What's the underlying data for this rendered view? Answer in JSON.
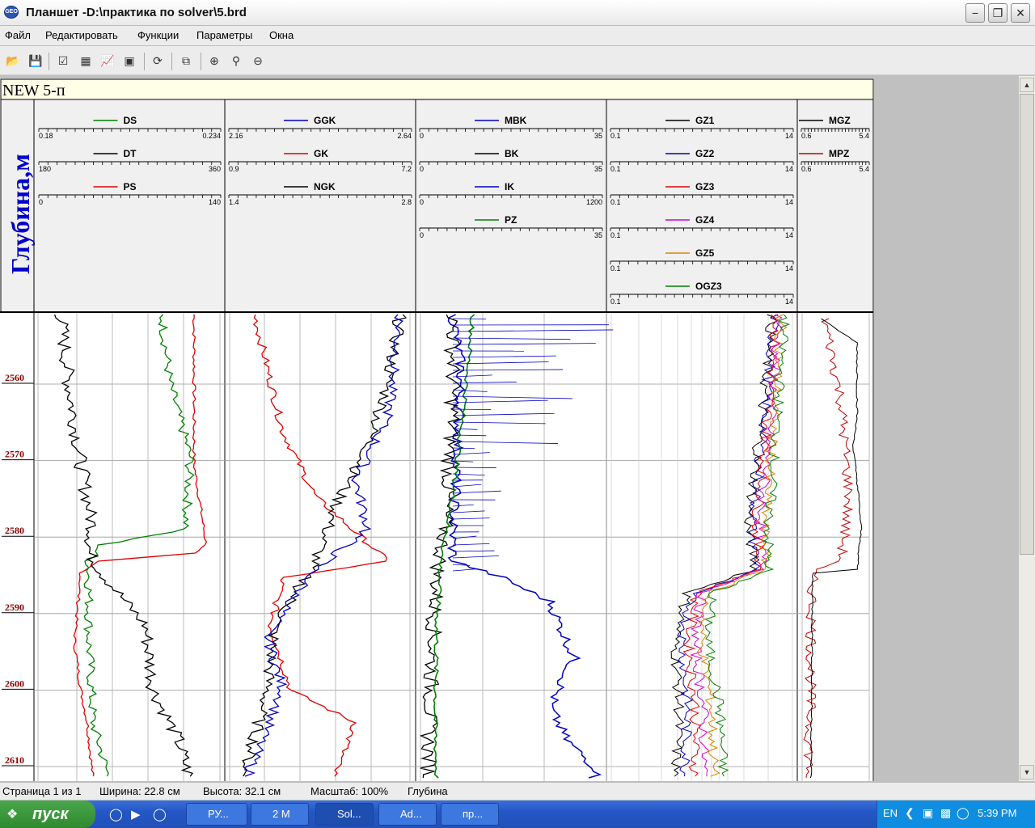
{
  "window": {
    "title": "Планшет -D:\\практика по solver\\5.brd",
    "app_icon": "GEO"
  },
  "menu": [
    "Файл",
    "Редактировать",
    "Функции",
    "Параметры",
    "Окна"
  ],
  "toolbar_icons": [
    "open-icon",
    "save-icon",
    "checklist-icon",
    "table-icon",
    "chart-icon",
    "image-icon",
    "refresh-icon",
    "copy-icon",
    "zoom-in-icon",
    "zoom-icon",
    "zoom-out-icon"
  ],
  "plot": {
    "well_name": "NEW 5-п",
    "depth_label": "Глубина,м",
    "depth_ticks": [
      "2560",
      "2570",
      "2580",
      "2590",
      "2600",
      "2610"
    ],
    "tracks": [
      {
        "curves": [
          {
            "name": "DS",
            "color": "#008000",
            "min": "0.18",
            "max": "0.234"
          },
          {
            "name": "DT",
            "color": "#000000",
            "min": "180",
            "max": "360"
          },
          {
            "name": "PS",
            "color": "#e00000",
            "min": "0",
            "max": "140"
          }
        ]
      },
      {
        "curves": [
          {
            "name": "GGK",
            "color": "#0000c0",
            "min": "2.16",
            "max": "2.64"
          },
          {
            "name": "GK",
            "color": "#e00000",
            "min": "0.9",
            "max": "7.2"
          },
          {
            "name": "NGK",
            "color": "#000000",
            "min": "1.4",
            "max": "2.8"
          }
        ]
      },
      {
        "curves": [
          {
            "name": "MBK",
            "color": "#0000c0",
            "min": "0",
            "max": "35"
          },
          {
            "name": "BK",
            "color": "#000000",
            "min": "0",
            "max": "35"
          },
          {
            "name": "IK",
            "color": "#0000c0",
            "min": "0",
            "max": "1200"
          },
          {
            "name": "PZ",
            "color": "#008000",
            "min": "0",
            "max": "35"
          }
        ]
      },
      {
        "curves": [
          {
            "name": "GZ1",
            "color": "#000000",
            "min": "0.1",
            "max": "14"
          },
          {
            "name": "GZ2",
            "color": "#0000c0",
            "min": "0.1",
            "max": "14"
          },
          {
            "name": "GZ3",
            "color": "#e00000",
            "min": "0.1",
            "max": "14"
          },
          {
            "name": "GZ4",
            "color": "#d000d0",
            "min": "0.1",
            "max": "14"
          },
          {
            "name": "GZ5",
            "color": "#e08000",
            "min": "0.1",
            "max": "14"
          },
          {
            "name": "OGZ3",
            "color": "#008000",
            "min": "0.1",
            "max": "14"
          }
        ]
      },
      {
        "curves": [
          {
            "name": "MGZ",
            "color": "#000000",
            "min": "0.6",
            "max": "5.4"
          },
          {
            "name": "MPZ",
            "color": "#c00000",
            "min": "0.6",
            "max": "5.4"
          }
        ]
      }
    ]
  },
  "status": {
    "page": "Страница 1 из 1",
    "width": "Ширина: 22.8 см",
    "height": "Высота: 32.1 см",
    "scale": "Масштаб: 100%",
    "mode": "Глубина"
  },
  "taskbar": {
    "start": "пуск",
    "tasks": [
      "РУ...",
      "2 M",
      "Sol...",
      "Ad...",
      "пр..."
    ],
    "lang": "EN",
    "time": "5:39 PM"
  }
}
